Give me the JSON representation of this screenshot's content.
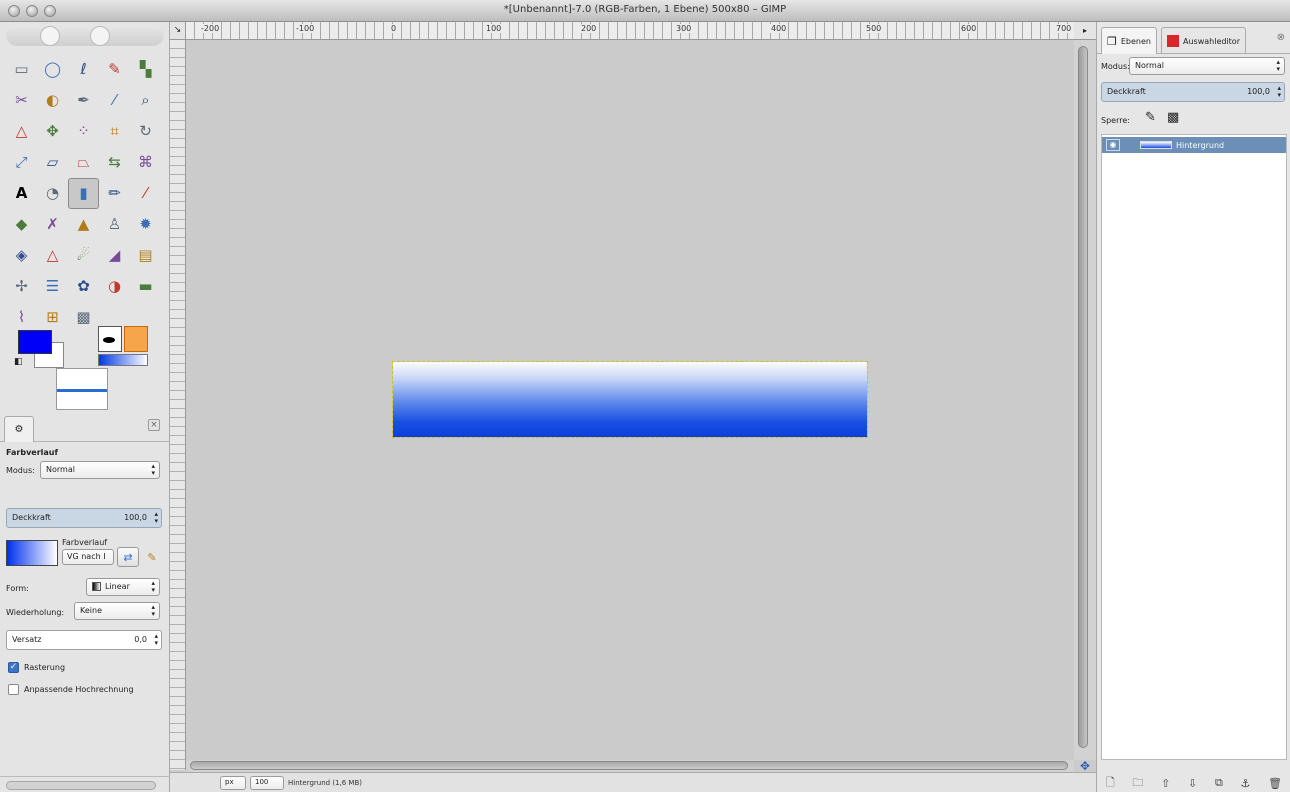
{
  "window": {
    "title": "*[Unbenannt]-7.0 (RGB-Farben, 1 Ebene) 500x80 – GIMP"
  },
  "toolbox": {
    "tools": [
      {
        "icon": "rect-select-icon",
        "glyph": "▭"
      },
      {
        "icon": "ellipse-select-icon",
        "glyph": "◯"
      },
      {
        "icon": "free-select-icon",
        "glyph": "ℓ"
      },
      {
        "icon": "fuzzy-select-icon",
        "glyph": "✎"
      },
      {
        "icon": "color-select-icon",
        "glyph": "▚"
      },
      {
        "icon": "scissors-select-icon",
        "glyph": "✂"
      },
      {
        "icon": "foreground-select-icon",
        "glyph": "◐"
      },
      {
        "icon": "paths-icon",
        "glyph": "✒"
      },
      {
        "icon": "color-picker-icon",
        "glyph": "⁄"
      },
      {
        "icon": "zoom-icon",
        "glyph": "⌕"
      },
      {
        "icon": "measure-icon",
        "glyph": "△"
      },
      {
        "icon": "move-icon",
        "glyph": "✥"
      },
      {
        "icon": "align-icon",
        "glyph": "⁘"
      },
      {
        "icon": "crop-icon",
        "glyph": "⌗"
      },
      {
        "icon": "rotate-icon",
        "glyph": "↻"
      },
      {
        "icon": "scale-icon",
        "glyph": "⤢"
      },
      {
        "icon": "shear-icon",
        "glyph": "▱"
      },
      {
        "icon": "perspective-icon",
        "glyph": "⏢"
      },
      {
        "icon": "flip-icon",
        "glyph": "⇆"
      },
      {
        "icon": "cage-transform-icon",
        "glyph": "⌘"
      },
      {
        "icon": "text-icon",
        "glyph": "A"
      },
      {
        "icon": "bucket-fill-icon",
        "glyph": "◔"
      },
      {
        "icon": "blend-icon",
        "glyph": "▮"
      },
      {
        "icon": "pencil-icon",
        "glyph": "✏"
      },
      {
        "icon": "paintbrush-icon",
        "glyph": "⁄"
      },
      {
        "icon": "eraser-icon",
        "glyph": "◆"
      },
      {
        "icon": "airbrush-icon",
        "glyph": "✗"
      },
      {
        "icon": "ink-icon",
        "glyph": "▲"
      },
      {
        "icon": "clone-icon",
        "glyph": "♙"
      },
      {
        "icon": "heal-icon",
        "glyph": "✹"
      },
      {
        "icon": "perspective-clone-icon",
        "glyph": "◈"
      },
      {
        "icon": "blur-icon",
        "glyph": "△"
      },
      {
        "icon": "smudge-icon",
        "glyph": "☄"
      },
      {
        "icon": "dodge-burn-icon",
        "glyph": "◢"
      },
      {
        "icon": "color-balance-icon",
        "glyph": "▤"
      },
      {
        "icon": "hue-saturation-icon",
        "glyph": "✢"
      },
      {
        "icon": "levels-icon",
        "glyph": "☰"
      },
      {
        "icon": "colorize-icon",
        "glyph": "✿"
      },
      {
        "icon": "contrast-icon",
        "glyph": "◑"
      },
      {
        "icon": "threshold-icon",
        "glyph": "▬"
      },
      {
        "icon": "curves-icon",
        "glyph": "⌇"
      },
      {
        "icon": "posterize-icon",
        "glyph": "⊞"
      },
      {
        "icon": "gradient-map-icon",
        "glyph": "▩"
      }
    ],
    "active_index": 22
  },
  "tool_options": {
    "title": "Farbverlauf",
    "modus_label": "Modus:",
    "modus_value": "Normal",
    "deckkraft_label": "Deckkraft",
    "deckkraft_value": "100,0",
    "farbverlauf_label": "Farbverlauf",
    "farbverlauf_value": "VG nach I",
    "form_label": "Form:",
    "form_value": "Linear",
    "wiederholung_label": "Wiederholung:",
    "wiederholung_value": "Keine",
    "versatz_label": "Versatz",
    "versatz_value": "0,0",
    "rasterung_label": "Rasterung",
    "rasterung_checked": true,
    "anpassende_label": "Anpassende Hochrechnung",
    "anpassende_checked": false
  },
  "ruler": {
    "corner": "↘",
    "labels": [
      "-200",
      "-100",
      "0",
      "100",
      "200",
      "300",
      "400",
      "500",
      "600",
      "700"
    ]
  },
  "statusbar": {
    "unit": "px",
    "zoom": "100",
    "status": "Hintergrund (1,6 MB)"
  },
  "layers_dock": {
    "tab_ebenen": "Ebenen",
    "tab_auswahleditor": "Auswahleditor",
    "modus_label": "Modus:",
    "modus_value": "Normal",
    "deckkraft_label": "Deckkraft",
    "deckkraft_value": "100,0",
    "sperre_label": "Sperre:",
    "layers": [
      {
        "name": "Hintergrund",
        "visible": true
      }
    ]
  },
  "colors": {
    "foreground": "#0000f8",
    "background": "#ffffff",
    "selection_bg": "#6b8fb6"
  }
}
